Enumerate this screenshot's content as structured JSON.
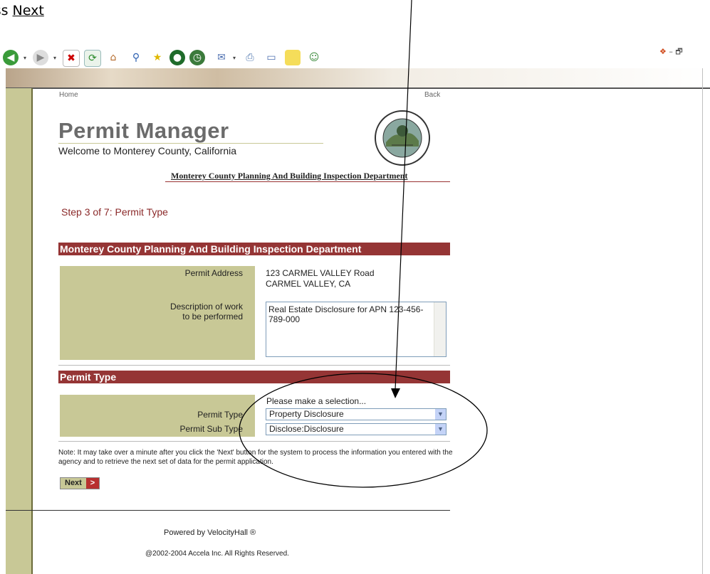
{
  "instruction": {
    "prefix": "ess ",
    "link": "Next"
  },
  "toolbar": {
    "icons": [
      "back-icon",
      "forward-icon",
      "stop-icon",
      "refresh-icon",
      "home-icon",
      "search-icon",
      "favorites-icon",
      "media-icon",
      "history-icon",
      "mail-icon",
      "print-icon",
      "edit-icon",
      "notes-icon",
      "messenger-icon"
    ]
  },
  "nav": {
    "home": "Home",
    "back": "Back"
  },
  "header": {
    "title": "Permit Manager",
    "subtitle": "Welcome to Monterey County, California",
    "department": "Monterey County Planning And Building Inspection Department"
  },
  "step": "Step 3 of 7: Permit Type",
  "section1": {
    "title": "Monterey County Planning And Building Inspection Department",
    "address_label": "Permit Address",
    "address_line1": "123 CARMEL VALLEY Road",
    "address_line2": "CARMEL VALLEY, CA",
    "desc_label_1": "Description of work",
    "desc_label_2": "to be performed",
    "desc_value": "Real Estate Disclosure for APN 123-456-789-000"
  },
  "section2": {
    "title": "Permit Type",
    "hint": "Please make a selection...",
    "type_label": "Permit Type",
    "type_value": "Property Disclosure",
    "subtype_label": "Permit Sub Type",
    "subtype_value": "Disclose:Disclosure"
  },
  "note": "Note: It may take over a minute after you click the 'Next' button for the system to process the information you entered with the agency and to retrieve the next set of data for the permit application.",
  "next_button": "Next",
  "footer": {
    "powered": "Powered by  VelocityHall ®",
    "copyright": "@2002-2004 Accela Inc. All Rights Reserved."
  },
  "colors": {
    "olive": "#c8c896",
    "maroon": "#953535",
    "title_gray": "#6b6b6b"
  }
}
